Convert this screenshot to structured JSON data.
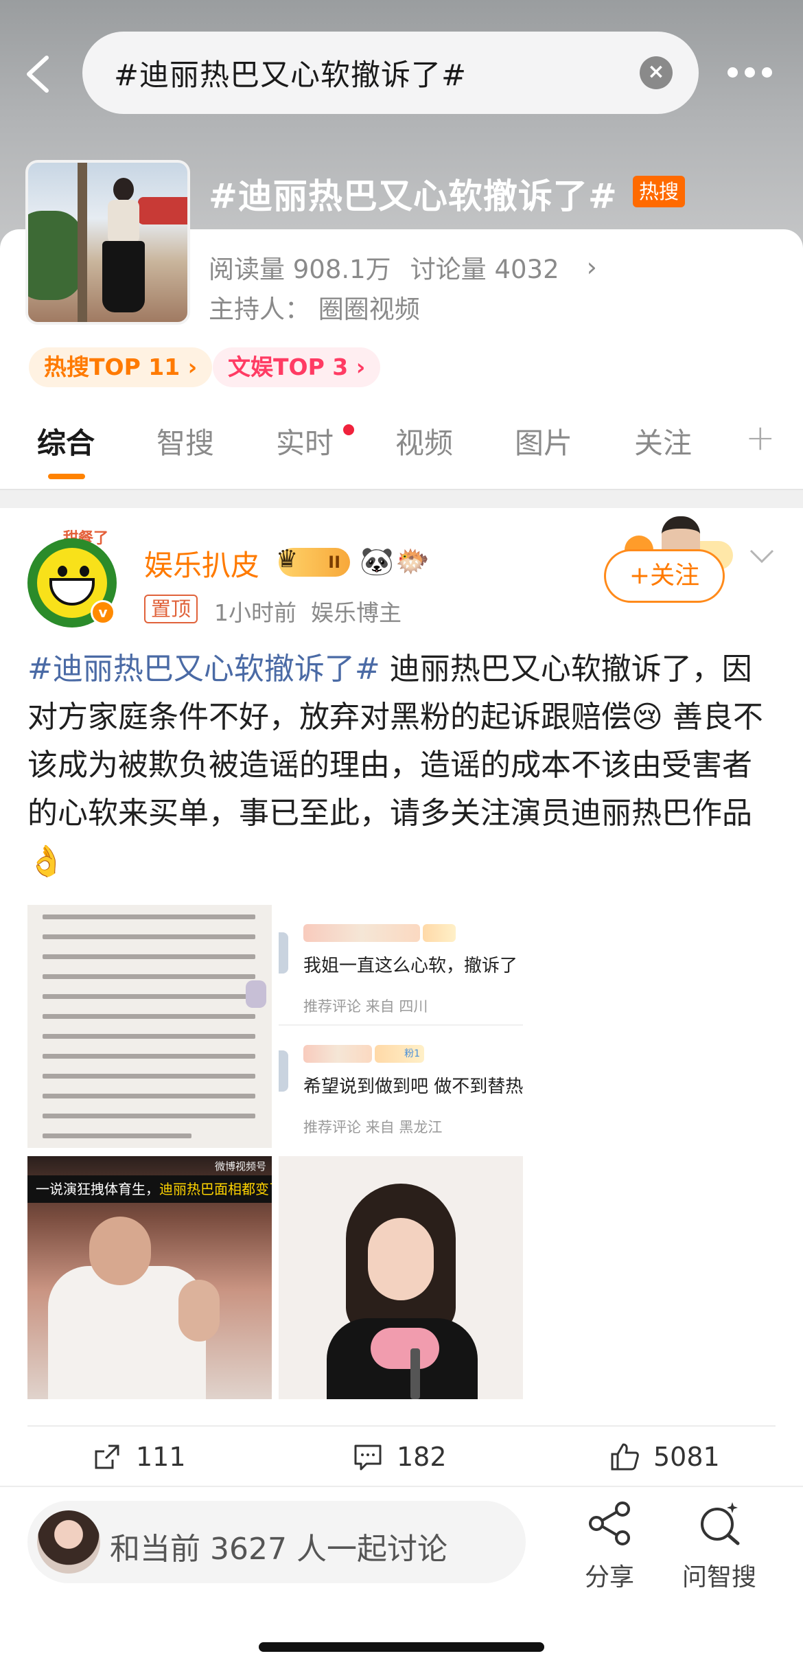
{
  "search": {
    "query": "#迪丽热巴又心软撤诉了#"
  },
  "topic": {
    "title": "#迪丽热巴又心软撤诉了#",
    "badge": "热搜",
    "reads": "阅读量 908.1万",
    "discussions": "讨论量 4032",
    "host": "主持人： 圈圈视频",
    "rank_hot": "热搜TOP 11",
    "rank_ent": "文娱TOP 3"
  },
  "tabs": [
    "综合",
    "智搜",
    "实时",
    "视频",
    "图片",
    "关注"
  ],
  "post": {
    "author": "娱乐扒皮",
    "avatar_caption": "甜餐了",
    "vip_level": "II",
    "emojis": [
      "🐼",
      "🐡"
    ],
    "pinned_label": "置顶",
    "meta": "1小时前  娱乐博主",
    "follow_label": "+关注",
    "text_tag": "#迪丽热巴又心软撤诉了#",
    "text_body": " 迪丽热巴又心软撤诉了，因对方家庭条件不好，放弃对黑粉的起诉跟赔偿😢 善良不该成为被欺负被造谣的理由，造谣的成本不该由受害者的心软来买单，事已至此，请多关注演员迪丽热巴作品👌"
  },
  "images": {
    "comment1": "我姐一直这么心软，撤诉了",
    "comment1_meta": "推荐评论  来自 四川",
    "comment2": "希望说到做到吧 做不到替热",
    "comment2_meta": "推荐评论  来自 黑龙江",
    "comment2_badge": "粉1",
    "video_banner_a": "一说演狂拽体育生，",
    "video_banner_b": "迪丽热巴面相都变了",
    "video_logo": "微博视频号"
  },
  "actions": {
    "reposts": "111",
    "comments": "182",
    "likes": "5081"
  },
  "bottom": {
    "discuss": "和当前 3627 人一起讨论",
    "share": "分享",
    "ask": "问智搜"
  },
  "colors": {
    "accent": "#ff8200",
    "hot_badge": "#ff6a00",
    "topic_link": "#4a6aa5"
  }
}
